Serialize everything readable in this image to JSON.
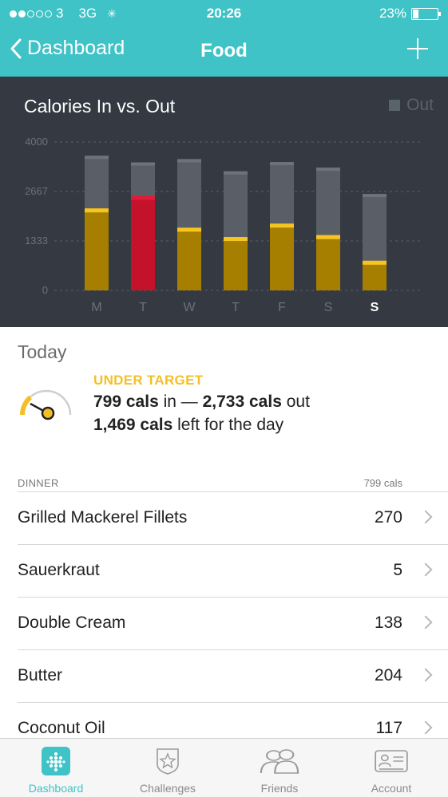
{
  "status_bar": {
    "carrier": "3",
    "network": "3G",
    "time": "20:26",
    "battery": "23%",
    "battery_level": 0.23
  },
  "nav": {
    "back_label": "Dashboard",
    "title": "Food"
  },
  "chart_data": {
    "type": "bar",
    "title": "Calories In vs. Out",
    "legend": [
      "Out"
    ],
    "legend_placement": "top-right",
    "categories": [
      "M",
      "T",
      "W",
      "T",
      "F",
      "S",
      "S"
    ],
    "highlight_index": 6,
    "yticks": [
      0,
      1333,
      2667,
      4000
    ],
    "ylim": [
      0,
      4000
    ],
    "series": [
      {
        "name": "Out",
        "values": [
          3630,
          3450,
          3540,
          3210,
          3460,
          3310,
          2600
        ]
      },
      {
        "values": [
          2210,
          2550,
          1690,
          1440,
          1800,
          1490,
          800
        ]
      }
    ],
    "over_target_index": 1,
    "colors": {
      "out": "#5a5f67",
      "out_cap": "#6e737b",
      "in": "#a77f00",
      "in_cap": "#f6c520",
      "in_over": "#c4122a",
      "in_over_cap": "#e31b36",
      "axis_text": "#6a717b",
      "highlight_text": "#ffffff",
      "grid": "#5a6068"
    }
  },
  "today": {
    "heading": "Today",
    "status": "UNDER TARGET",
    "cals_in": "799 cals",
    "in_suffix": " in — ",
    "cals_out": "2,733 cals",
    "out_suffix": " out",
    "cals_left": "1,469 cals",
    "left_suffix": " left for the day"
  },
  "meal": {
    "name": "DINNER",
    "total": "799 cals",
    "items": [
      {
        "name": "Grilled Mackerel Fillets",
        "cals": "270"
      },
      {
        "name": "Sauerkraut",
        "cals": "5"
      },
      {
        "name": "Double Cream",
        "cals": "138"
      },
      {
        "name": "Butter",
        "cals": "204"
      },
      {
        "name": "Coconut Oil",
        "cals": "117"
      }
    ]
  },
  "tabs": [
    {
      "label": "Dashboard",
      "icon": "dashboard-icon",
      "active": true
    },
    {
      "label": "Challenges",
      "icon": "challenges-icon",
      "active": false
    },
    {
      "label": "Friends",
      "icon": "friends-icon",
      "active": false
    },
    {
      "label": "Account",
      "icon": "account-icon",
      "active": false
    }
  ],
  "accent_color": "#3fc3c6"
}
